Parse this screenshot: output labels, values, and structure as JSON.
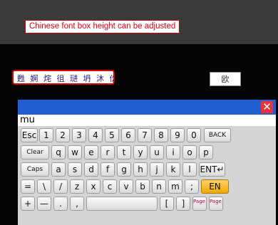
{
  "banner": "Chinese font box height can be adjusted",
  "candidates": "甦 婀 烢 徂 琎 坍 沐 伀",
  "cn_key_label": "欧",
  "input_value": "mu",
  "keyboard": {
    "row1": [
      "Esc",
      "1",
      "2",
      "3",
      "4",
      "5",
      "6",
      "7",
      "8",
      "9",
      "0",
      "BACK"
    ],
    "row2": [
      "Clear",
      "q",
      "w",
      "e",
      "r",
      "t",
      "y",
      "u",
      "i",
      "o",
      "p"
    ],
    "row3": [
      "Caps",
      "a",
      "s",
      "d",
      "f",
      "g",
      "h",
      "j",
      "k",
      "l",
      "ENT↵"
    ],
    "row4": [
      "=",
      "\\",
      "/",
      "z",
      "x",
      "c",
      "v",
      "b",
      "n",
      "m",
      ";",
      "EN"
    ],
    "row5": [
      "+",
      "—",
      ".",
      ",",
      "",
      "[",
      "]",
      "Page Up",
      "Page Down"
    ]
  },
  "close_icon": "✕",
  "colors": {
    "accent_blue": "#1f5fd0",
    "close_red": "#e8323c",
    "en_key": "#f0a800",
    "highlight_red": "#d10000"
  }
}
